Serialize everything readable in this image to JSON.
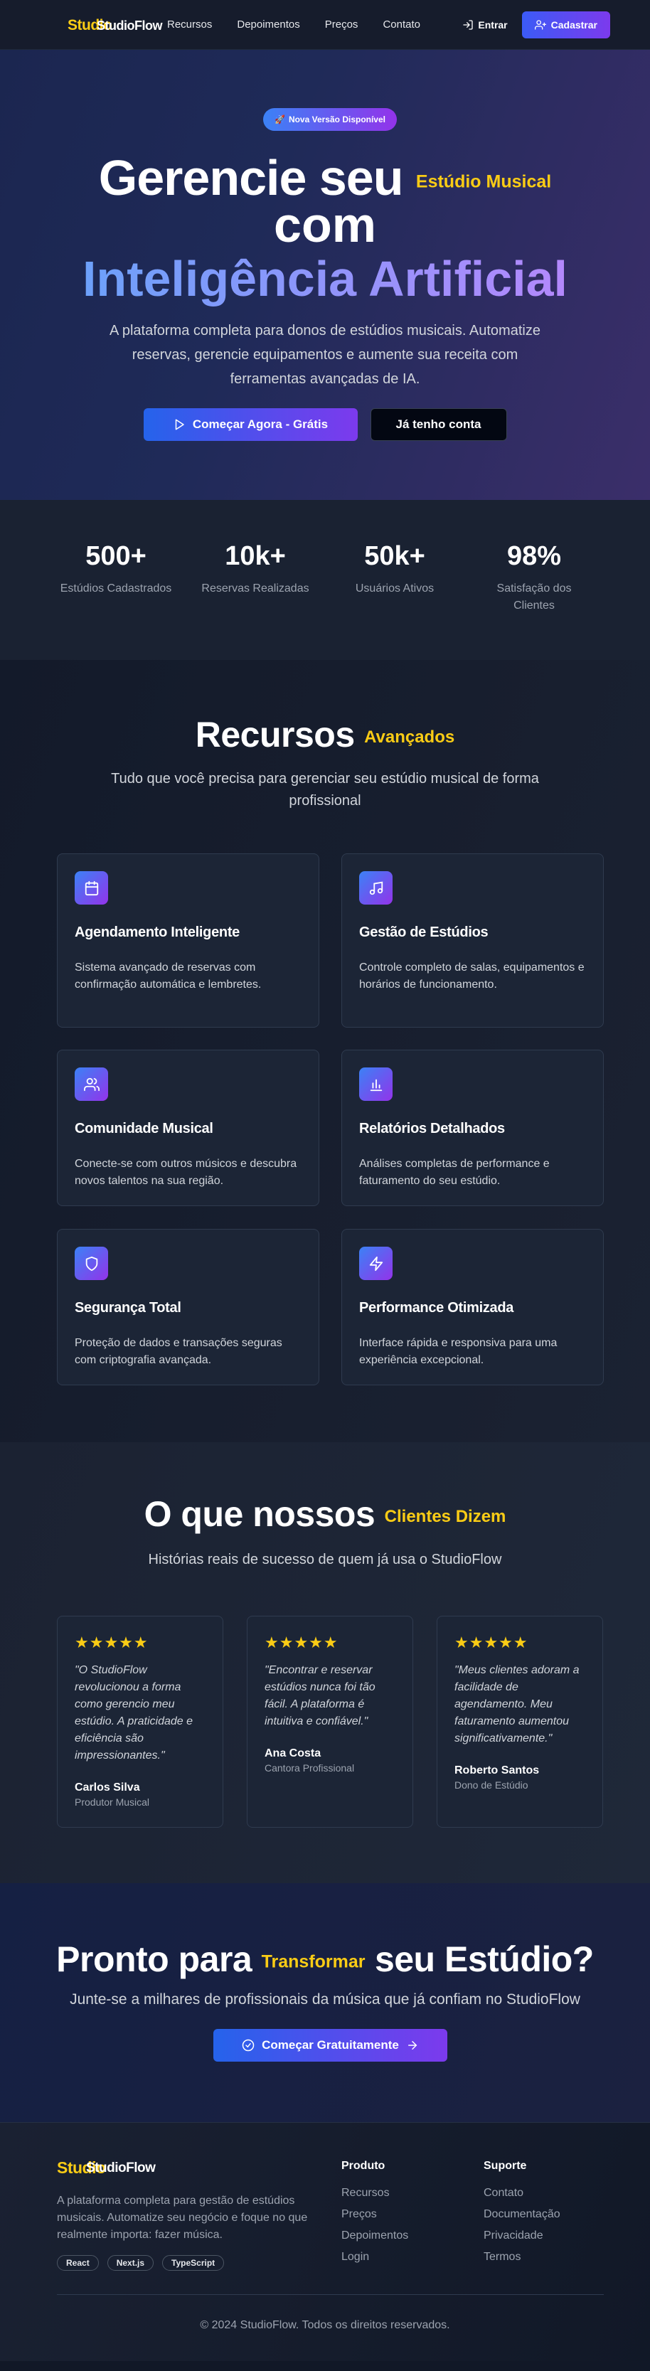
{
  "nav": {
    "logo_part1": "Studio",
    "logo_part2": "StudioFlow",
    "links": [
      "Recursos",
      "Depoimentos",
      "Preços",
      "Contato"
    ],
    "enter": "Entrar",
    "signup": "Cadastrar"
  },
  "hero": {
    "badge": "Nova Versão Disponível",
    "title_line1": "Gerencie seu",
    "title_highlight": "Estúdio Musical",
    "title_line2": "com",
    "title_line3": "Inteligência Artificial",
    "subtitle": "A plataforma completa para donos de estúdios musicais. Automatize reservas, gerencie equipamentos e aumente sua receita com ferramentas avançadas de IA.",
    "cta_primary": "Começar Agora - Grátis",
    "cta_secondary": "Já tenho conta"
  },
  "stats": [
    {
      "value": "500+",
      "label": "Estúdios Cadastrados"
    },
    {
      "value": "10k+",
      "label": "Reservas Realizadas"
    },
    {
      "value": "50k+",
      "label": "Usuários Ativos"
    },
    {
      "value": "98%",
      "label": "Satisfação dos Clientes"
    }
  ],
  "features": {
    "title": "Recursos",
    "title_highlight": "Avançados",
    "subtitle": "Tudo que você precisa para gerenciar seu estúdio musical de forma profissional",
    "items": [
      {
        "icon": "calendar-icon",
        "title": "Agendamento Inteligente",
        "desc": "Sistema avançado de reservas com confirmação automática e lembretes."
      },
      {
        "icon": "music-icon",
        "title": "Gestão de Estúdios",
        "desc": "Controle completo de salas, equipamentos e horários de funcionamento."
      },
      {
        "icon": "users-icon",
        "title": "Comunidade Musical",
        "desc": "Conecte-se com outros músicos e descubra novos talentos na sua região."
      },
      {
        "icon": "bar-chart-icon",
        "title": "Relatórios Detalhados",
        "desc": "Análises completas de performance e faturamento do seu estúdio."
      },
      {
        "icon": "shield-icon",
        "title": "Segurança Total",
        "desc": "Proteção de dados e transações seguras com criptografia avançada."
      },
      {
        "icon": "lightning-icon",
        "title": "Performance Otimizada",
        "desc": "Interface rápida e responsiva para uma experiência excepcional."
      }
    ]
  },
  "testimonials": {
    "title": "O que nossos",
    "title_highlight": "Clientes Dizem",
    "subtitle": "Histórias reais de sucesso de quem já usa o StudioFlow",
    "stars": "★★★★★",
    "items": [
      {
        "quote": "\"O StudioFlow revolucionou a forma como gerencio meu estúdio. A praticidade e eficiência são impressionantes.\"",
        "name": "Carlos Silva",
        "role": "Produtor Musical"
      },
      {
        "quote": "\"Encontrar e reservar estúdios nunca foi tão fácil. A plataforma é intuitiva e confiável.\"",
        "name": "Ana Costa",
        "role": "Cantora Profissional"
      },
      {
        "quote": "\"Meus clientes adoram a facilidade de agendamento. Meu faturamento aumentou significativamente.\"",
        "name": "Roberto Santos",
        "role": "Dono de Estúdio"
      }
    ]
  },
  "cta": {
    "title_part1": "Pronto para",
    "title_highlight": "Transformar",
    "title_part2": "seu Estúdio?",
    "subtitle": "Junte-se a milhares de profissionais da música que já confiam no StudioFlow",
    "button": "Começar Gratuitamente"
  },
  "footer": {
    "logo_part1": "Studio",
    "logo_part2": "StudioFlow",
    "desc": "A plataforma completa para gestão de estúdios musicais. Automatize seu negócio e foque no que realmente importa: fazer música.",
    "tags": [
      "React",
      "Next.js",
      "TypeScript"
    ],
    "col1_title": "Produto",
    "col1_links": [
      "Recursos",
      "Preços",
      "Depoimentos",
      "Login"
    ],
    "col2_title": "Suporte",
    "col2_links": [
      "Contato",
      "Documentação",
      "Privacidade",
      "Termos"
    ],
    "copyright": "© 2024 StudioFlow. Todos os direitos reservados."
  },
  "colors": {
    "accent_yellow": "#facc15",
    "gradient_blue": "#2563eb",
    "gradient_purple": "#7c3aed"
  }
}
